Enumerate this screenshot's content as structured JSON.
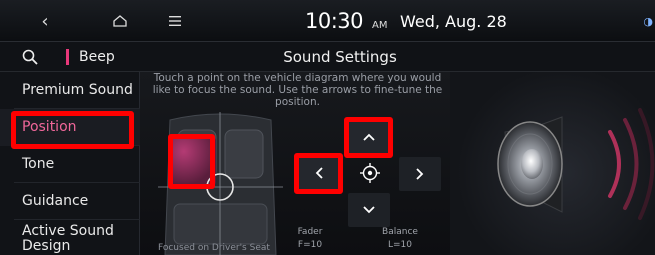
{
  "topbar": {
    "back_icon": "chevron-left-icon",
    "home_icon": "home-icon",
    "menu_icon": "menu-icon",
    "time": "10:30",
    "ampm": "AM",
    "date": "Wed, Aug. 28",
    "status_icon": "connection-icon"
  },
  "subbar": {
    "search_icon": "search-icon",
    "beep_label": "Beep",
    "title": "Sound Settings"
  },
  "sidebar": {
    "items": [
      {
        "label": "Premium Sound"
      },
      {
        "label": "Position"
      },
      {
        "label": "Tone"
      },
      {
        "label": "Guidance"
      },
      {
        "label": "Active Sound\nDesign"
      }
    ],
    "active_index": 1
  },
  "main": {
    "instruction": "Touch a point on the vehicle diagram where you would like to focus the sound. Use the arrows to fine-tune the position.",
    "focus_label": "Focused on Driver's Seat",
    "fader_label": "Fader",
    "fader_value": "F=10",
    "balance_label": "Balance",
    "balance_value": "L=10"
  },
  "colors": {
    "accent": "#e8387a",
    "highlight": "#ff0000",
    "background": "#000000"
  }
}
